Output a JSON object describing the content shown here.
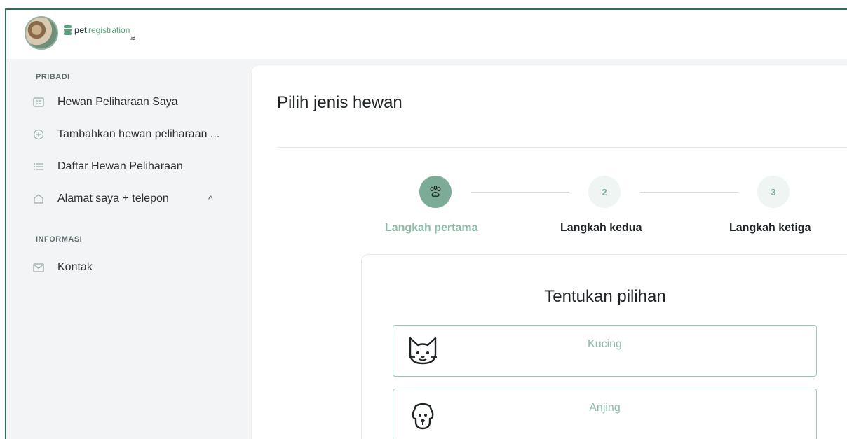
{
  "brand": {
    "name_bold": "pet",
    "name_light": "registration",
    "tld": ".id"
  },
  "sidebar": {
    "section_personal": "PRIBADI",
    "section_info": "INFORMASI",
    "items": [
      {
        "label": "Hewan Peliharaan Saya",
        "icon": "id-card-icon"
      },
      {
        "label": "Tambahkan hewan peliharaan ...",
        "icon": "plus-circle-icon"
      },
      {
        "label": "Daftar Hewan Peliharaan",
        "icon": "list-icon"
      },
      {
        "label": "Alamat saya + telepon",
        "icon": "home-icon",
        "caret": "^"
      },
      {
        "label": "Kontak",
        "icon": "mail-icon"
      }
    ]
  },
  "main": {
    "title": "Pilih jenis hewan",
    "steps": [
      {
        "number": "",
        "icon": "paw-icon",
        "label": "Langkah pertama",
        "active": true
      },
      {
        "number": "2",
        "label": "Langkah kedua",
        "active": false
      },
      {
        "number": "3",
        "label": "Langkah ketiga",
        "active": false
      }
    ],
    "card": {
      "title": "Tentukan pilihan",
      "options": [
        {
          "label": "Kucing",
          "icon": "cat-icon"
        },
        {
          "label": "Anjing",
          "icon": "dog-icon"
        }
      ]
    }
  },
  "colors": {
    "accent": "#7cab98",
    "accent_light": "#eef5f2",
    "frame": "#2f6e5c"
  }
}
